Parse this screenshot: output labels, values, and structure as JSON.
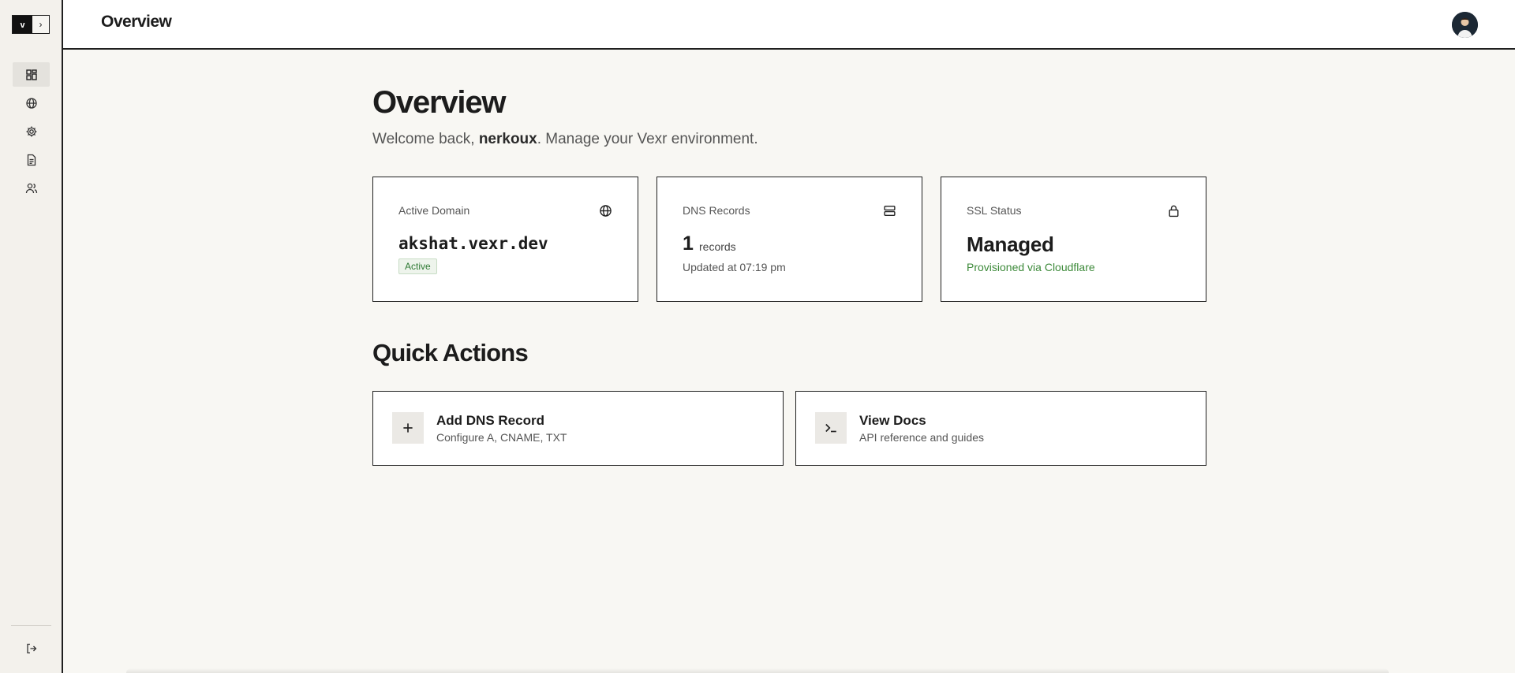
{
  "app": {
    "logo_letter": "v",
    "expand_glyph": "›"
  },
  "header": {
    "title": "Overview"
  },
  "sidebar": {
    "items": [
      {
        "name": "dashboard",
        "icon": "dashboard-icon",
        "active": true
      },
      {
        "name": "domains",
        "icon": "globe-icon",
        "active": false
      },
      {
        "name": "settings",
        "icon": "gear-icon",
        "active": false
      },
      {
        "name": "docs",
        "icon": "document-icon",
        "active": false
      },
      {
        "name": "users",
        "icon": "users-icon",
        "active": false
      }
    ],
    "logout_icon": "logout-icon"
  },
  "main": {
    "title": "Overview",
    "welcome_prefix": "Welcome back, ",
    "username": "nerkoux",
    "welcome_suffix": ". Manage your Vexr environment."
  },
  "stats": {
    "domain": {
      "label": "Active Domain",
      "value": "akshat.vexr.dev",
      "badge": "Active",
      "icon": "globe-icon"
    },
    "dns": {
      "label": "DNS Records",
      "count": "1",
      "unit": "records",
      "updated": "Updated at 07:19 pm",
      "icon": "server-icon"
    },
    "ssl": {
      "label": "SSL Status",
      "value": "Managed",
      "sub": "Provisioned via Cloudflare",
      "icon": "lock-icon"
    }
  },
  "quick_actions": {
    "title": "Quick Actions",
    "items": [
      {
        "title": "Add DNS Record",
        "subtitle": "Configure A, CNAME, TXT",
        "icon": "plus-icon"
      },
      {
        "title": "View Docs",
        "subtitle": "API reference and guides",
        "icon": "terminal-icon"
      }
    ]
  },
  "colors": {
    "accent_green": "#3d8a3a",
    "border": "#1f1f1f",
    "background": "#f8f7f3"
  }
}
